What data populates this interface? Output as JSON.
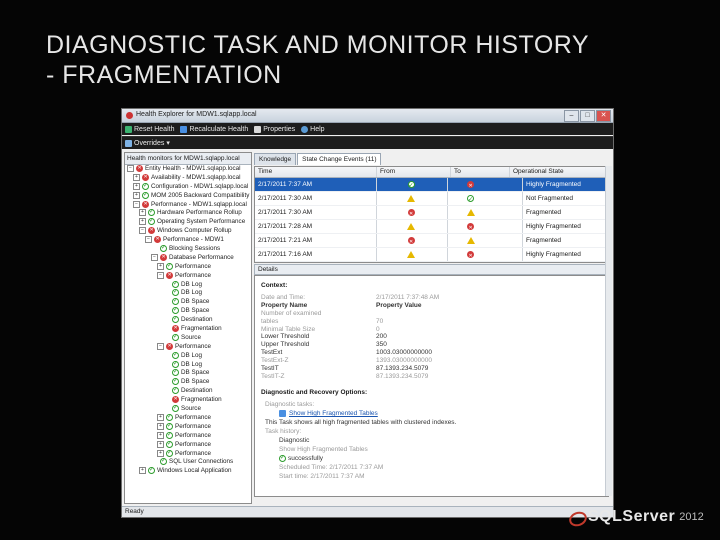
{
  "slide": {
    "title_line1": "DIAGNOSTIC TASK AND MONITOR HISTORY",
    "title_line2": "- FRAGMENTATION"
  },
  "window": {
    "title": "Health Explorer for MDW1.sqlapp.local",
    "min": "–",
    "max": "□",
    "close": "✕"
  },
  "toolbar": {
    "reset_health": "Reset Health",
    "recalculate_health": "Recalculate Health",
    "properties": "Properties",
    "help": "Help",
    "overrides": "Overrides"
  },
  "tree": {
    "header": "Health monitors for MDW1.sqlapp.local",
    "items": [
      {
        "label": "Entity Health - MDW1.sqlapp.local",
        "status": "err",
        "indent": 0,
        "exp": "−"
      },
      {
        "label": "Availability - MDW1.sqlapp.local",
        "status": "err",
        "indent": 1,
        "exp": "+"
      },
      {
        "label": "Configuration - MDW1.sqlapp.local",
        "status": "ok",
        "indent": 1,
        "exp": "+"
      },
      {
        "label": "MOM 2005 Backward Compatibility",
        "status": "ok",
        "indent": 1,
        "exp": "+"
      },
      {
        "label": "Performance - MDW1.sqlapp.local",
        "status": "err",
        "indent": 1,
        "exp": "−"
      },
      {
        "label": "Hardware Performance Rollup",
        "status": "ok",
        "indent": 2,
        "exp": "+"
      },
      {
        "label": "Operating System Performance",
        "status": "ok",
        "indent": 2,
        "exp": "+"
      },
      {
        "label": "Windows Computer Rollup",
        "status": "err",
        "indent": 2,
        "exp": "−"
      },
      {
        "label": "Performance - MDW1",
        "status": "err",
        "indent": 3,
        "exp": "−"
      },
      {
        "label": "Blocking Sessions",
        "status": "ok",
        "indent": 4,
        "exp": ""
      },
      {
        "label": "Database Performance",
        "status": "err",
        "indent": 4,
        "exp": "−"
      },
      {
        "label": "Performance",
        "status": "ok",
        "indent": 5,
        "exp": "+"
      },
      {
        "label": "Performance",
        "status": "err",
        "indent": 5,
        "exp": "−"
      },
      {
        "label": "DB Log",
        "status": "ok",
        "indent": 6,
        "exp": ""
      },
      {
        "label": "DB Log",
        "status": "ok",
        "indent": 6,
        "exp": ""
      },
      {
        "label": "DB Space",
        "status": "ok",
        "indent": 6,
        "exp": ""
      },
      {
        "label": "DB Space",
        "status": "ok",
        "indent": 6,
        "exp": ""
      },
      {
        "label": "Destination",
        "status": "ok",
        "indent": 6,
        "exp": ""
      },
      {
        "label": "Fragmentation",
        "status": "err",
        "indent": 6,
        "exp": ""
      },
      {
        "label": "Source",
        "status": "ok",
        "indent": 6,
        "exp": ""
      },
      {
        "label": "Performance",
        "status": "err",
        "indent": 5,
        "exp": "−"
      },
      {
        "label": "DB Log",
        "status": "ok",
        "indent": 6,
        "exp": ""
      },
      {
        "label": "DB Log",
        "status": "ok",
        "indent": 6,
        "exp": ""
      },
      {
        "label": "DB Space",
        "status": "ok",
        "indent": 6,
        "exp": ""
      },
      {
        "label": "DB Space",
        "status": "ok",
        "indent": 6,
        "exp": ""
      },
      {
        "label": "Destination",
        "status": "ok",
        "indent": 6,
        "exp": ""
      },
      {
        "label": "Fragmentation",
        "status": "err",
        "indent": 6,
        "exp": ""
      },
      {
        "label": "Source",
        "status": "ok",
        "indent": 6,
        "exp": ""
      },
      {
        "label": "Performance",
        "status": "ok",
        "indent": 5,
        "exp": "+"
      },
      {
        "label": "Performance",
        "status": "ok",
        "indent": 5,
        "exp": "+"
      },
      {
        "label": "Performance",
        "status": "ok",
        "indent": 5,
        "exp": "+"
      },
      {
        "label": "Performance",
        "status": "ok",
        "indent": 5,
        "exp": "+"
      },
      {
        "label": "Performance",
        "status": "ok",
        "indent": 5,
        "exp": "+"
      },
      {
        "label": "SQL User Connections",
        "status": "ok",
        "indent": 4,
        "exp": ""
      },
      {
        "label": "Windows Local Application",
        "status": "ok",
        "indent": 2,
        "exp": "+"
      }
    ]
  },
  "tabs": [
    "Knowledge",
    "State Change Events (11)"
  ],
  "grid": {
    "headers": {
      "time": "Time",
      "from": "From",
      "to": "To",
      "state": "Operational State"
    },
    "rows": [
      {
        "time": "2/17/2011 7:37 AM",
        "from": "ok",
        "to": "err",
        "state": "Highly Fragmented",
        "selected": true
      },
      {
        "time": "2/17/2011 7:30 AM",
        "from": "warn",
        "to": "ok",
        "state": "Not Fragmented",
        "selected": false
      },
      {
        "time": "2/17/2011 7:30 AM",
        "from": "err",
        "to": "warn",
        "state": "Fragmented",
        "selected": false
      },
      {
        "time": "2/17/2011 7:28 AM",
        "from": "warn",
        "to": "err",
        "state": "Highly Fragmented",
        "selected": false
      },
      {
        "time": "2/17/2011 7:21 AM",
        "from": "err",
        "to": "warn",
        "state": "Fragmented",
        "selected": false
      },
      {
        "time": "2/17/2011 7:16 AM",
        "from": "warn",
        "to": "err",
        "state": "Highly Fragmented",
        "selected": false
      }
    ]
  },
  "details": {
    "header": "Details",
    "context_title": "Context:",
    "props": [
      {
        "k": "Date and Time:",
        "v": "2/17/2011 7:37:48 AM",
        "cls": "dim"
      },
      {
        "k": "Property Name",
        "v": "Property Value",
        "cls": "head"
      },
      {
        "k": "Number of examined",
        "v": "",
        "cls": "dim"
      },
      {
        "k": "tables",
        "v": "70",
        "cls": "dim"
      },
      {
        "k": "Minimal Table Size",
        "v": "0",
        "cls": "dim"
      },
      {
        "k": "Lower Threshold",
        "v": "200",
        "cls": ""
      },
      {
        "k": "Upper Threshold",
        "v": "350",
        "cls": ""
      },
      {
        "k": "TestExt",
        "v": "1003.03000000000",
        "cls": ""
      },
      {
        "k": "TestExt-Z",
        "v": "1393.03000000000",
        "cls": "dim"
      },
      {
        "k": "TestIT",
        "v": "87.1393.234.5079",
        "cls": ""
      },
      {
        "k": "TestIT-Z",
        "v": "87.1393.234.5079",
        "cls": "dim"
      }
    ],
    "diag_title": "Diagnostic and Recovery Options:",
    "diag_lines": [
      {
        "text": "Diagnostic tasks:",
        "cls": "dim"
      },
      {
        "text": "Show High Fragmented Tables",
        "cls": "link"
      },
      {
        "text": "This Task shows all high fragmented tables with clustered indexes.",
        "cls": ""
      },
      {
        "text": "Task history:",
        "cls": "dim"
      },
      {
        "text": "Diagnostic",
        "cls": ""
      },
      {
        "text": "Show High Fragmented Tables",
        "cls": "dim"
      },
      {
        "text": "successfully",
        "cls": ""
      },
      {
        "text": "Scheduled Time: 2/17/2011 7:37 AM",
        "cls": "dim"
      },
      {
        "text": "Start time: 2/17/2011 7:37 AM",
        "cls": "dim"
      }
    ]
  },
  "status": "Ready",
  "logo": {
    "brand": "SQLServer",
    "year": "2012"
  }
}
